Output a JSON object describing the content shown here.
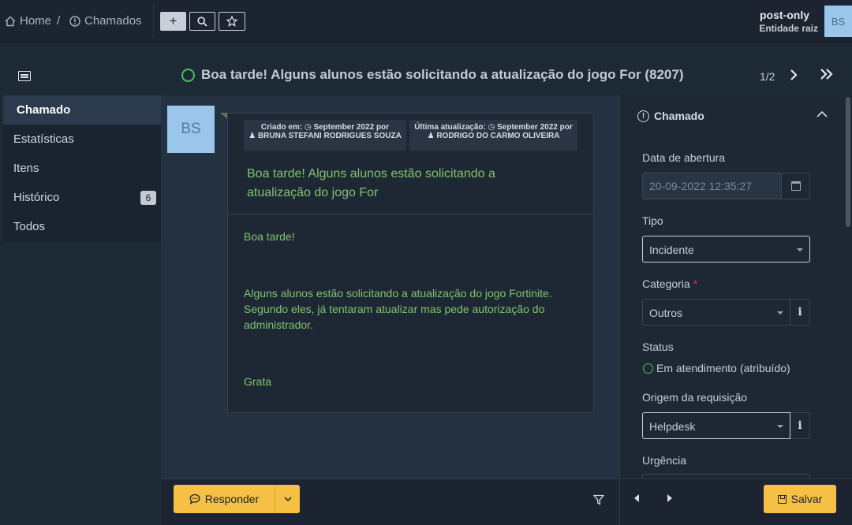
{
  "topbar": {
    "breadcrumb": [
      {
        "label": "Home",
        "icon": "home-icon"
      },
      {
        "label": "Chamados",
        "icon": "alert-circle-icon"
      }
    ],
    "separator": "/",
    "add_symbol": "+",
    "search_symbol": "⚲",
    "star_symbol": "☆",
    "user": {
      "name": "post-only",
      "entity": "Entidade raiz",
      "initials": "BS"
    }
  },
  "sidebar": {
    "items": [
      {
        "label": "Chamado",
        "active": true
      },
      {
        "label": "Estatísticas"
      },
      {
        "label": "Itens"
      },
      {
        "label": "Histórico",
        "badge": "6"
      },
      {
        "label": "Todos"
      }
    ]
  },
  "ticket": {
    "title": "Boa tarde!   Alguns alunos estão solicitando a atualização do jogo For (8207)",
    "pager": "1/2"
  },
  "timeline": {
    "avatar_initials": "BS",
    "created_label": "Criado em:",
    "created_value": "September 2022 por",
    "created_by": "BRUNA STEFANI RODRIGUES SOUZA",
    "updated_label": "Última atualização:",
    "updated_value": "September 2022 por",
    "updated_by": "RODRIGO DO CARMO OLIVEIRA",
    "title": "Boa tarde!   Alguns alunos estão solicitando a atualização do jogo For",
    "body": [
      "Boa tarde!",
      "Alguns alunos estão solicitando a atualização do jogo Fortinite. Segundo eles, já tentaram atualizar mas pede autorização do administrador.",
      "Grata"
    ]
  },
  "actions": {
    "reply_label": "Responder",
    "save_label": "Salvar"
  },
  "panel": {
    "header": "Chamado",
    "fields": {
      "opening_date_label": "Data de abertura",
      "opening_date_value": "20-09-2022 12:35:27",
      "type_label": "Tipo",
      "type_value": "Incidente",
      "category_label": "Categoria",
      "category_required": "*",
      "category_value": "Outros",
      "status_label": "Status",
      "status_value": "Em atendimento (atribuído)",
      "origin_label": "Origem da requisição",
      "origin_value": "Helpdesk",
      "urgency_label": "Urgência"
    }
  },
  "colors": {
    "accent": "#f5c043",
    "status_green": "#4cbb5e",
    "content_green": "#7fc46e",
    "required_red": "#e0344a"
  }
}
